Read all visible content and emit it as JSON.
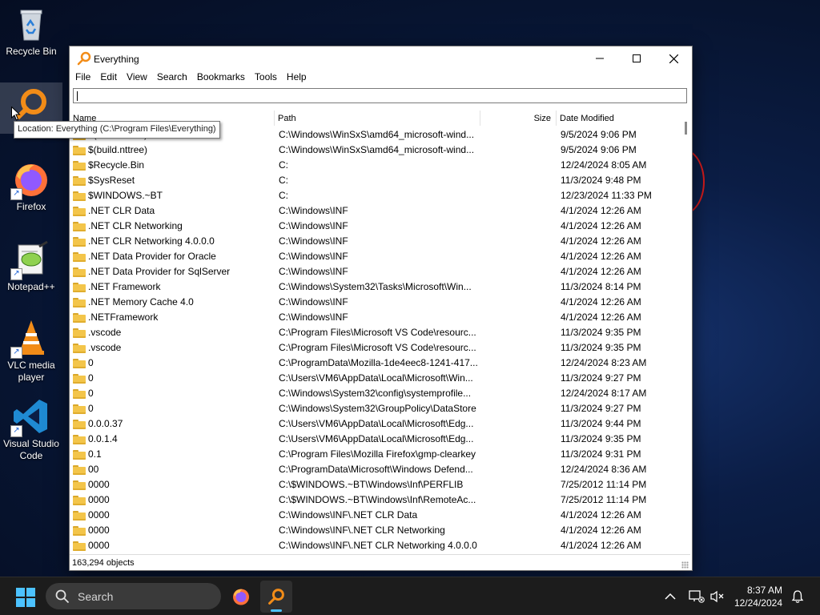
{
  "desktop": {
    "icons": [
      {
        "label": "Recycle Bin",
        "icon": "recycle-bin-icon"
      },
      {
        "label": "",
        "icon": "everything-icon"
      },
      {
        "label": "Firefox",
        "icon": "firefox-icon"
      },
      {
        "label": "Notepad++",
        "icon": "notepad-plus-plus-icon"
      },
      {
        "label": "VLC media player",
        "icon": "vlc-icon"
      },
      {
        "label": "Visual Studio Code",
        "icon": "vscode-icon"
      }
    ],
    "tooltip": "Location: Everything (C:\\Program Files\\Everything)"
  },
  "window": {
    "title": "Everything",
    "menu": [
      "File",
      "Edit",
      "View",
      "Search",
      "Bookmarks",
      "Tools",
      "Help"
    ],
    "search": {
      "value": "",
      "placeholder": ""
    },
    "columns": {
      "name": "Name",
      "path": "Path",
      "size": "Size",
      "date": "Date Modified"
    },
    "rows": [
      {
        "name": "$(build.nttree)",
        "path": "C:\\Windows\\WinSxS\\amd64_microsoft-wind...",
        "size": "",
        "date": "9/5/2024 9:06 PM"
      },
      {
        "name": "$(build.nttree)",
        "path": "C:\\Windows\\WinSxS\\amd64_microsoft-wind...",
        "size": "",
        "date": "9/5/2024 9:06 PM"
      },
      {
        "name": "$Recycle.Bin",
        "path": "C:",
        "size": "",
        "date": "12/24/2024 8:05 AM"
      },
      {
        "name": "$SysReset",
        "path": "C:",
        "size": "",
        "date": "11/3/2024 9:48 PM"
      },
      {
        "name": "$WINDOWS.~BT",
        "path": "C:",
        "size": "",
        "date": "12/23/2024 11:33 PM"
      },
      {
        "name": ".NET CLR Data",
        "path": "C:\\Windows\\INF",
        "size": "",
        "date": "4/1/2024 12:26 AM"
      },
      {
        "name": ".NET CLR Networking",
        "path": "C:\\Windows\\INF",
        "size": "",
        "date": "4/1/2024 12:26 AM"
      },
      {
        "name": ".NET CLR Networking 4.0.0.0",
        "path": "C:\\Windows\\INF",
        "size": "",
        "date": "4/1/2024 12:26 AM"
      },
      {
        "name": ".NET Data Provider for Oracle",
        "path": "C:\\Windows\\INF",
        "size": "",
        "date": "4/1/2024 12:26 AM"
      },
      {
        "name": ".NET Data Provider for SqlServer",
        "path": "C:\\Windows\\INF",
        "size": "",
        "date": "4/1/2024 12:26 AM"
      },
      {
        "name": ".NET Framework",
        "path": "C:\\Windows\\System32\\Tasks\\Microsoft\\Win...",
        "size": "",
        "date": "11/3/2024 8:14 PM"
      },
      {
        "name": ".NET Memory Cache 4.0",
        "path": "C:\\Windows\\INF",
        "size": "",
        "date": "4/1/2024 12:26 AM"
      },
      {
        "name": ".NETFramework",
        "path": "C:\\Windows\\INF",
        "size": "",
        "date": "4/1/2024 12:26 AM"
      },
      {
        "name": ".vscode",
        "path": "C:\\Program Files\\Microsoft VS Code\\resourc...",
        "size": "",
        "date": "11/3/2024 9:35 PM"
      },
      {
        "name": ".vscode",
        "path": "C:\\Program Files\\Microsoft VS Code\\resourc...",
        "size": "",
        "date": "11/3/2024 9:35 PM"
      },
      {
        "name": "0",
        "path": "C:\\ProgramData\\Mozilla-1de4eec8-1241-417...",
        "size": "",
        "date": "12/24/2024 8:23 AM"
      },
      {
        "name": "0",
        "path": "C:\\Users\\VM6\\AppData\\Local\\Microsoft\\Win...",
        "size": "",
        "date": "11/3/2024 9:27 PM"
      },
      {
        "name": "0",
        "path": "C:\\Windows\\System32\\config\\systemprofile...",
        "size": "",
        "date": "12/24/2024 8:17 AM"
      },
      {
        "name": "0",
        "path": "C:\\Windows\\System32\\GroupPolicy\\DataStore",
        "size": "",
        "date": "11/3/2024 9:27 PM"
      },
      {
        "name": "0.0.0.37",
        "path": "C:\\Users\\VM6\\AppData\\Local\\Microsoft\\Edg...",
        "size": "",
        "date": "11/3/2024 9:44 PM"
      },
      {
        "name": "0.0.1.4",
        "path": "C:\\Users\\VM6\\AppData\\Local\\Microsoft\\Edg...",
        "size": "",
        "date": "11/3/2024 9:35 PM"
      },
      {
        "name": "0.1",
        "path": "C:\\Program Files\\Mozilla Firefox\\gmp-clearkey",
        "size": "",
        "date": "11/3/2024 9:31 PM"
      },
      {
        "name": "00",
        "path": "C:\\ProgramData\\Microsoft\\Windows Defend...",
        "size": "",
        "date": "12/24/2024 8:36 AM"
      },
      {
        "name": "0000",
        "path": "C:\\$WINDOWS.~BT\\Windows\\Inf\\PERFLIB",
        "size": "",
        "date": "7/25/2012 11:14 PM"
      },
      {
        "name": "0000",
        "path": "C:\\$WINDOWS.~BT\\Windows\\Inf\\RemoteAc...",
        "size": "",
        "date": "7/25/2012 11:14 PM"
      },
      {
        "name": "0000",
        "path": "C:\\Windows\\INF\\.NET CLR Data",
        "size": "",
        "date": "4/1/2024 12:26 AM"
      },
      {
        "name": "0000",
        "path": "C:\\Windows\\INF\\.NET CLR Networking",
        "size": "",
        "date": "4/1/2024 12:26 AM"
      },
      {
        "name": "0000",
        "path": "C:\\Windows\\INF\\.NET CLR Networking 4.0.0.0",
        "size": "",
        "date": "4/1/2024 12:26 AM"
      }
    ],
    "status": "163,294 objects"
  },
  "taskbar": {
    "search_label": "Search",
    "time": "8:37 AM",
    "date": "12/24/2024"
  },
  "colors": {
    "accent": "#4cc2ff",
    "folder": "#f3c54a",
    "everything_orange": "#f28c18"
  }
}
